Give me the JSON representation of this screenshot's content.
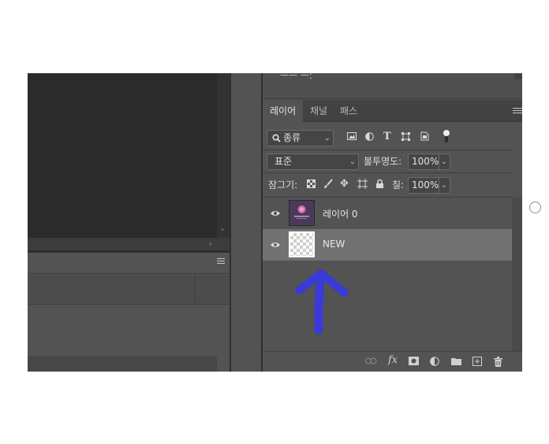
{
  "panel_top": {
    "cut_text": "ㅡㅡ ㅡ:"
  },
  "tabs": [
    {
      "label": "레이어",
      "active": true
    },
    {
      "label": "채널",
      "active": false
    },
    {
      "label": "패스",
      "active": false
    }
  ],
  "filter": {
    "kind_label": "종류"
  },
  "blend": {
    "mode": "표준",
    "opacity_label": "불투명도:",
    "opacity_value": "100%"
  },
  "lock": {
    "label": "잠그기:",
    "fill_label": "칠:",
    "fill_value": "100%"
  },
  "layers": [
    {
      "name": "레이어 0",
      "visible": true,
      "selected": false,
      "thumb": "purple"
    },
    {
      "name": "NEW",
      "visible": true,
      "selected": true,
      "thumb": "transparent"
    }
  ],
  "annotation": {
    "arrow_color": "#3a3ad8"
  },
  "icons": {
    "footer": [
      "link-icon",
      "fx-icon",
      "mask-icon",
      "adjustment-icon",
      "folder-icon",
      "new-layer-icon",
      "trash-icon"
    ]
  }
}
